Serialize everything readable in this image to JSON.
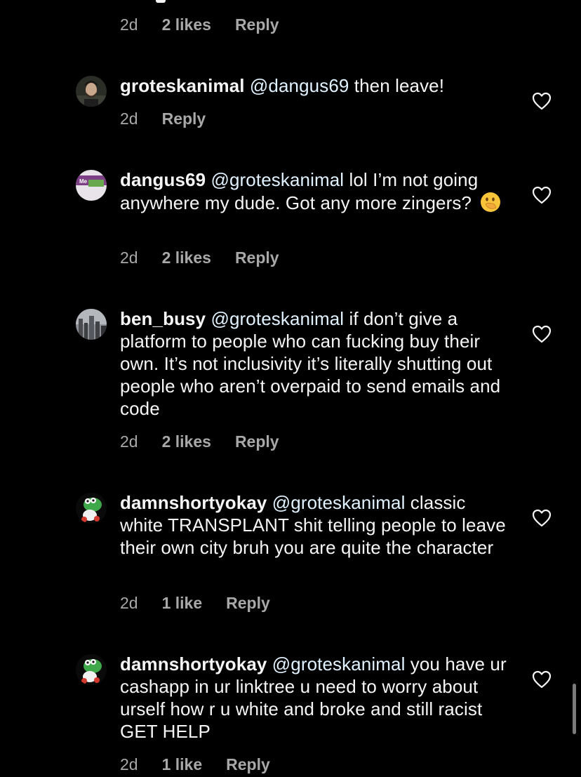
{
  "top_meta": {
    "age": "2d",
    "likes": "2 likes",
    "reply": "Reply"
  },
  "comments": [
    {
      "username": "groteskanimal",
      "mention": "@dangus69",
      "text": " then leave!",
      "age": "2d",
      "likes": "",
      "reply": "Reply",
      "avatar": "person-avatar"
    },
    {
      "username": "dangus69",
      "mention": "@groteskanimal",
      "text": " lol I’m not going anywhere my dude. Got any more zingers?",
      "emoji": "face-with-hand-over-mouth",
      "age": "2d",
      "likes": "2 likes",
      "reply": "Reply",
      "avatar": "me-badge-avatar",
      "avatar_text": "Me"
    },
    {
      "username": "ben_busy",
      "mention": "@groteskanimal",
      "text": " if don’t give a platform to people who can fucking buy their own. It’s not inclusivity it’s literally shutting out people who aren’t overpaid to send emails and code",
      "age": "2d",
      "likes": "2 likes",
      "reply": "Reply",
      "avatar": "cityscape-avatar"
    },
    {
      "username": "damnshortyokay",
      "mention": "@groteskanimal",
      "text": " classic white TRANSPLANT shit telling people to leave their own city bruh you are quite the character",
      "age": "2d",
      "likes": "1 like",
      "reply": "Reply",
      "avatar": "yoshi-avatar"
    },
    {
      "username": "damnshortyokay",
      "mention": "@groteskanimal",
      "text": " you have ur cashapp in ur linktree u need to worry about urself how r u white and broke and still racist GET HELP",
      "age": "2d",
      "likes": "1 like",
      "reply": "Reply",
      "avatar": "yoshi-avatar"
    }
  ],
  "colors": {
    "background": "#000000",
    "text": "#f5f5f5",
    "muted": "#a8a8a8",
    "mention": "#e0f1ff"
  }
}
